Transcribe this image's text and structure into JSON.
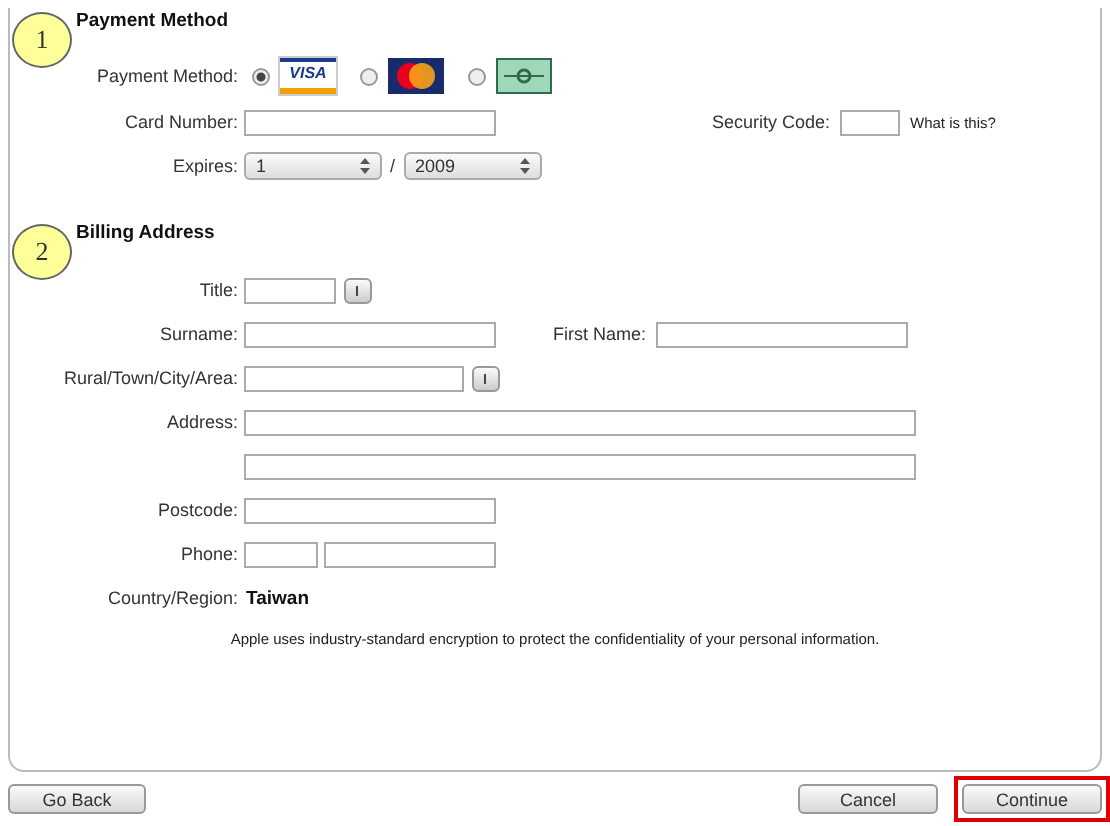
{
  "payment": {
    "number": "1",
    "title": "Payment Method",
    "method_label": "Payment Method:",
    "options": [
      {
        "kind": "visa",
        "text": "VISA",
        "selected": true
      },
      {
        "kind": "mastercard",
        "selected": false
      },
      {
        "kind": "other",
        "selected": false
      }
    ],
    "card_number_label": "Card Number:",
    "security_code_label": "Security Code:",
    "security_help_link": "What is this?",
    "expires_label": "Expires:",
    "expires_month": "1",
    "expires_separator": "/",
    "expires_year": "2009"
  },
  "billing": {
    "number": "2",
    "title": "Billing Address",
    "title_label": "Title:",
    "surname_label": "Surname:",
    "first_name_label": "First Name:",
    "area_label": "Rural/Town/City/Area:",
    "address_label": "Address:",
    "postcode_label": "Postcode:",
    "phone_label": "Phone:",
    "country_label": "Country/Region:",
    "country_value": "Taiwan"
  },
  "note": "Apple uses industry-standard encryption to protect the confidentiality of your personal information.",
  "buttons": [
    {
      "kind": "back",
      "label": "Go Back",
      "highlighted": false
    },
    {
      "kind": "cancel",
      "label": "Cancel",
      "highlighted": false
    },
    {
      "kind": "continue",
      "label": "Continue",
      "highlighted": true
    }
  ]
}
